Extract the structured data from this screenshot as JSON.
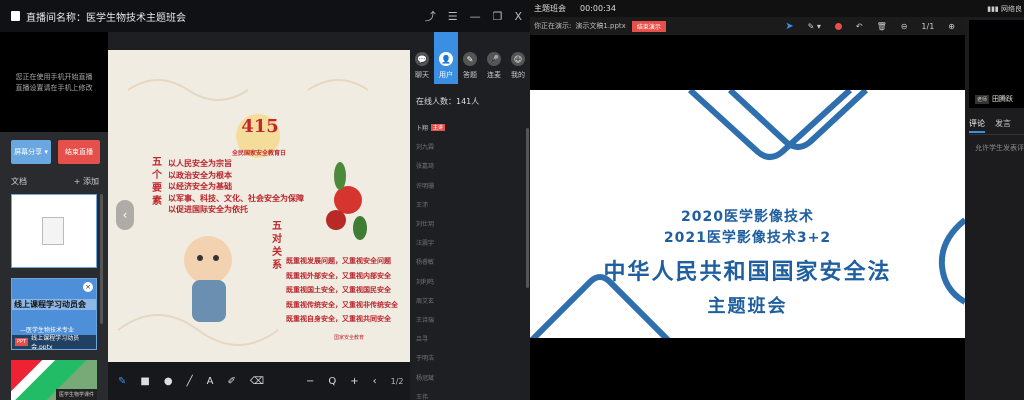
{
  "left_window": {
    "title": "直播间名称：医学生物技术主题班会",
    "controls": {
      "share": "⤴",
      "menu": "☰",
      "min": "—",
      "restore": "❐",
      "close": "X"
    },
    "preview_text": [
      "您正在使用手机开始直播",
      "直播设置请在手机上修改"
    ],
    "buttons": {
      "share_screen": "屏幕分享 ▾",
      "end_live": "结束直播"
    },
    "docs": {
      "header": "文档",
      "add": "+ 添加"
    },
    "thumbnails": [
      {
        "caption": ""
      },
      {
        "title": "线上课程学习动员会",
        "subtitle": "—医学生物技术专业",
        "caption": "线上课程学习动员会.pptx",
        "tag": "PPT"
      },
      {
        "caption": "医学生物学课件"
      }
    ],
    "slide": {
      "title": "415",
      "subtitle": "全民国家安全教育日",
      "vertical_left": "五个要素",
      "list_left": [
        "以人民安全为宗旨",
        "以政治安全为根本",
        "以经济安全为基础",
        "以军事、科技、文化、社会安全为保障",
        "以促进国际安全为依托"
      ],
      "vertical_right": "五对关系",
      "list_right": [
        "既重视发展问题，又重视安全问题",
        "既重视外部安全，又重视内部安全",
        "既重视国土安全，又重视国民安全",
        "既重视传统安全，又重视非传统安全",
        "既重视自身安全，又重视共同安全"
      ],
      "sign": "国家安全教育"
    },
    "toolbar": {
      "pen": "✎",
      "rect": "■",
      "circle": "●",
      "line": "╱",
      "text": "A",
      "eraser": "✐",
      "clear": "⌫",
      "minus": "−",
      "zoom": "Q",
      "plus": "+",
      "prev": "‹",
      "page": "1/2",
      "next": "›"
    },
    "nav_prev": "‹",
    "panel": {
      "tabs": [
        {
          "label": "聊天",
          "icon": "💬"
        },
        {
          "label": "用户",
          "icon": "👤"
        },
        {
          "label": "答题",
          "icon": "✎"
        },
        {
          "label": "连麦",
          "icon": "🎤"
        },
        {
          "label": "我的",
          "icon": "☺"
        }
      ],
      "online": "在线人数：141人",
      "users": [
        {
          "name": "卜翔",
          "badge": "主讲"
        },
        {
          "name": "刘九霖"
        },
        {
          "name": "张嘉琦"
        },
        {
          "name": "许明珊"
        },
        {
          "name": "王沛"
        },
        {
          "name": "刘仕玥"
        },
        {
          "name": "汪震宇"
        },
        {
          "name": "杨睿敏"
        },
        {
          "name": "刘利鸣"
        },
        {
          "name": "周艾玄"
        },
        {
          "name": "王诗瑞"
        },
        {
          "name": "吕寻"
        },
        {
          "name": "于明洁"
        },
        {
          "name": "杨冠斌"
        },
        {
          "name": "王伟"
        }
      ]
    }
  },
  "right_window": {
    "title": "主题班会",
    "timer": "00:00:34",
    "presenting_label": "你正在演示:",
    "presenting_file": "演示文稿1.pptx",
    "end_demo": "结束演示",
    "tools": {
      "pointer": "➤",
      "pen": "✎ ▾",
      "undo": "↶",
      "delete": "🗑",
      "zoom_out": "⊖",
      "page": "1/1",
      "zoom_in": "⊕"
    },
    "slide": {
      "line1": "2020医学影像技术",
      "line2": "2021医学影像技术3+2",
      "line3": "中华人民共和国国家安全法",
      "line4": "主题班会"
    }
  },
  "far_right": {
    "status": "网络良",
    "name_label": "老师",
    "name": "田腾跃",
    "tabs": [
      "评论",
      "发言"
    ],
    "hint": "允许学生发表评论"
  },
  "colors": {
    "accent": "#3a8fe3",
    "danger": "#e5504b",
    "slide_blue": "#1f5fa0",
    "poster_red": "#c0282d"
  }
}
